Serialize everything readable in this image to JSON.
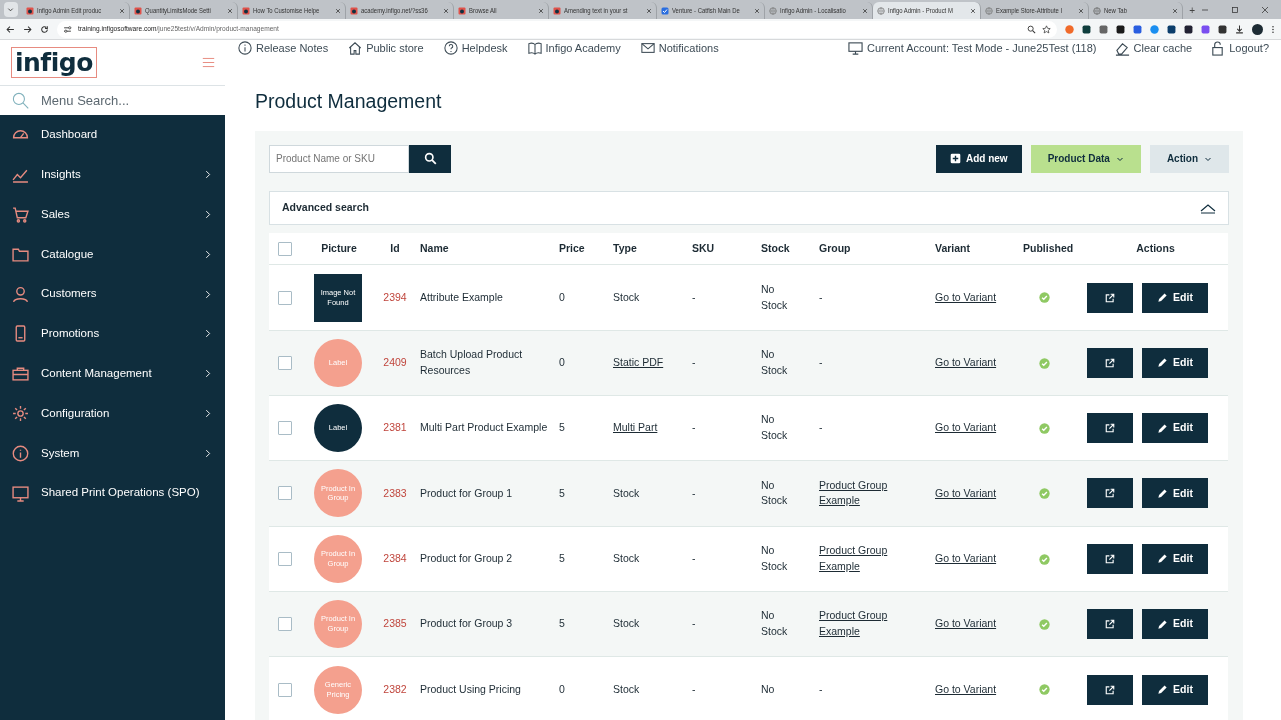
{
  "browser": {
    "tabs": [
      {
        "title": "Infigo Admin Edit produc",
        "selected": false
      },
      {
        "title": "QuantityLimitsMode Setti",
        "selected": false
      },
      {
        "title": "How To Customise Helpe",
        "selected": false
      },
      {
        "title": "academy.infigo.net/?ss36",
        "selected": false
      },
      {
        "title": "Browse All",
        "selected": false
      },
      {
        "title": "Amending text in your st",
        "selected": false
      },
      {
        "title": "Venture - Catfish Main De",
        "selected": false
      },
      {
        "title": "Infigo Admin - Localisatio",
        "selected": false
      },
      {
        "title": "Infigo Admin - Product M",
        "selected": true
      },
      {
        "title": "Example Store-Attribute I",
        "selected": false
      },
      {
        "title": "New Tab",
        "selected": false
      }
    ],
    "new_tab": "+",
    "url": {
      "host": "training.infigosoftware.com",
      "path": "/june25test/v/Admin/product-management"
    }
  },
  "sidebar": {
    "logo": "infigo",
    "search": {
      "placeholder": "Menu Search..."
    },
    "items": [
      {
        "label": "Dashboard",
        "expandable": false
      },
      {
        "label": "Insights",
        "expandable": true
      },
      {
        "label": "Sales",
        "expandable": true
      },
      {
        "label": "Catalogue",
        "expandable": true
      },
      {
        "label": "Customers",
        "expandable": true
      },
      {
        "label": "Promotions",
        "expandable": true
      },
      {
        "label": "Content Management",
        "expandable": true
      },
      {
        "label": "Configuration",
        "expandable": true
      },
      {
        "label": "System",
        "expandable": true
      },
      {
        "label": "Shared Print Operations (SPO)",
        "expandable": false
      }
    ]
  },
  "header": {
    "links": [
      "Release Notes",
      "Public store",
      "Helpdesk",
      "Infigo Academy",
      "Notifications"
    ],
    "right_links": [
      "Current Account: Test Mode - June25Test (118)",
      "Clear cache",
      "Logout?"
    ]
  },
  "page_title": "Product Management",
  "toolbar": {
    "search": {
      "placeholder": "Product Name or SKU"
    },
    "add_new": "Add new",
    "product_data": "Product Data",
    "action": "Action"
  },
  "advanced_search": {
    "label": "Advanced search",
    "expanded": false
  },
  "table": {
    "select_all": false,
    "columns": [
      "Picture",
      "Id",
      "Name",
      "Price",
      "Type",
      "SKU",
      "Stock",
      "Group",
      "Variant",
      "Published",
      "Actions"
    ],
    "rows": [
      {
        "checked": false,
        "thumb": {
          "kind": "square",
          "color": "#0f2d3d",
          "label": "Image Not Found"
        },
        "id": "2394",
        "name": "Attribute Example",
        "price": "0",
        "type": {
          "text": "Stock",
          "link": false
        },
        "sku": "-",
        "stock": "No Stock",
        "group": {
          "text": "-",
          "link": false
        },
        "variant": "Go to Variant",
        "published": true,
        "edit": "Edit"
      },
      {
        "checked": false,
        "thumb": {
          "kind": "circle",
          "color": "#f4a08e",
          "label": "Label"
        },
        "id": "2409",
        "name": "Batch Upload Product Resources",
        "price": "0",
        "type": {
          "text": "Static PDF",
          "link": true
        },
        "sku": "-",
        "stock": "No Stock",
        "group": {
          "text": "-",
          "link": false
        },
        "variant": "Go to Variant",
        "published": true,
        "edit": "Edit"
      },
      {
        "checked": false,
        "thumb": {
          "kind": "circle",
          "color": "#0f2d3d",
          "label": "Label"
        },
        "id": "2381",
        "name": "Multi Part Product Example",
        "price": "5",
        "type": {
          "text": "Multi Part",
          "link": true
        },
        "sku": "-",
        "stock": "No Stock",
        "group": {
          "text": "-",
          "link": false
        },
        "variant": "Go to Variant",
        "published": true,
        "edit": "Edit"
      },
      {
        "checked": false,
        "thumb": {
          "kind": "circle",
          "color": "#f4a08e",
          "label": "Product In Group"
        },
        "id": "2383",
        "name": "Product for Group 1",
        "price": "5",
        "type": {
          "text": "Stock",
          "link": false
        },
        "sku": "-",
        "stock": "No Stock",
        "group": {
          "text": "Product Group Example",
          "link": true
        },
        "variant": "Go to Variant",
        "published": true,
        "edit": "Edit"
      },
      {
        "checked": false,
        "thumb": {
          "kind": "circle",
          "color": "#f4a08e",
          "label": "Product In Group"
        },
        "id": "2384",
        "name": "Product for Group 2",
        "price": "5",
        "type": {
          "text": "Stock",
          "link": false
        },
        "sku": "-",
        "stock": "No Stock",
        "group": {
          "text": "Product Group Example",
          "link": true
        },
        "variant": "Go to Variant",
        "published": true,
        "edit": "Edit"
      },
      {
        "checked": false,
        "thumb": {
          "kind": "circle",
          "color": "#f4a08e",
          "label": "Product In Group"
        },
        "id": "2385",
        "name": "Product for Group 3",
        "price": "5",
        "type": {
          "text": "Stock",
          "link": false
        },
        "sku": "-",
        "stock": "No Stock",
        "group": {
          "text": "Product Group Example",
          "link": true
        },
        "variant": "Go to Variant",
        "published": true,
        "edit": "Edit"
      },
      {
        "checked": false,
        "thumb": {
          "kind": "circle",
          "color": "#f4a08e",
          "label": "Generic Pricing"
        },
        "id": "2382",
        "name": "Product Using Pricing",
        "price": "0",
        "type": {
          "text": "Stock",
          "link": false
        },
        "sku": "-",
        "stock": "No",
        "group": {
          "text": "-",
          "link": false
        },
        "variant": "Go to Variant",
        "published": true,
        "edit": "Edit"
      }
    ]
  }
}
